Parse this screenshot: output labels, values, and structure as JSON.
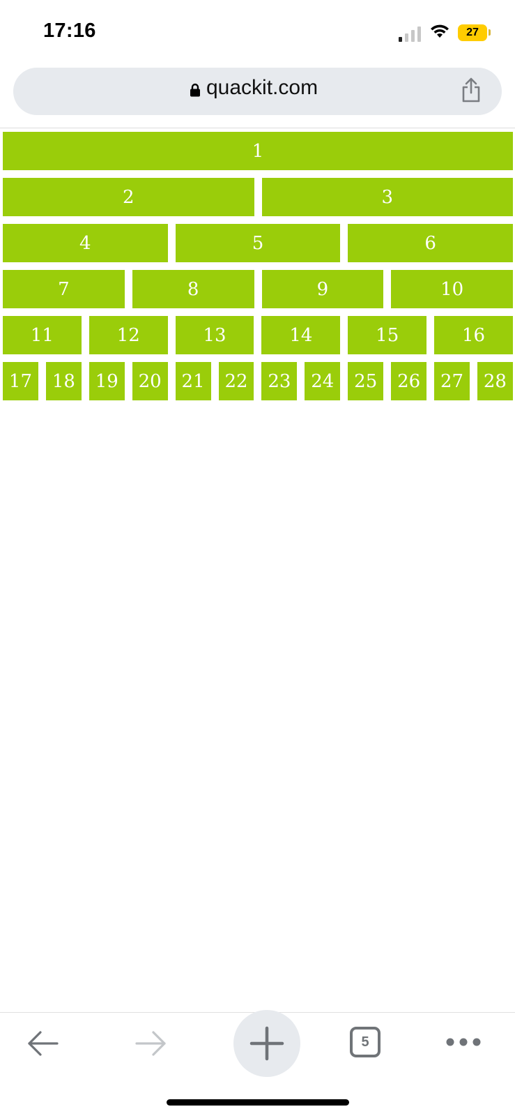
{
  "status_bar": {
    "time": "17:16",
    "battery": "27",
    "battery_color": "#ffcc00"
  },
  "browser": {
    "url": "quackit.com",
    "open_tabs": "5"
  },
  "grid": {
    "cell_color": "#9acd0a",
    "rows": [
      [
        "1"
      ],
      [
        "2",
        "3"
      ],
      [
        "4",
        "5",
        "6"
      ],
      [
        "7",
        "8",
        "9",
        "10"
      ],
      [
        "11",
        "12",
        "13",
        "14",
        "15",
        "16"
      ],
      [
        "17",
        "18",
        "19",
        "20",
        "21",
        "22",
        "23",
        "24",
        "25",
        "26",
        "27",
        "28"
      ]
    ]
  },
  "icons": {
    "lock": "lock-icon",
    "share": "share-icon",
    "back": "arrow-left-icon",
    "forward": "arrow-right-icon",
    "new_tab": "plus-icon",
    "more": "more-dots-icon",
    "signal": "cellular-signal-icon",
    "wifi": "wifi-icon"
  }
}
